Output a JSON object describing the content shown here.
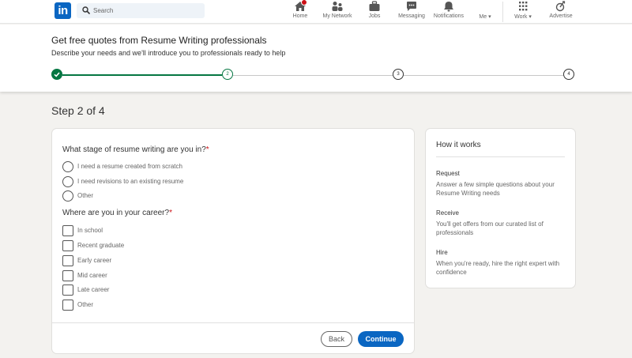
{
  "nav": {
    "logo_text": "in",
    "search_placeholder": "Search",
    "items": [
      {
        "label": "Home"
      },
      {
        "label": "My Network"
      },
      {
        "label": "Jobs"
      },
      {
        "label": "Messaging"
      },
      {
        "label": "Notifications"
      },
      {
        "label": "Me"
      },
      {
        "label": "Work"
      },
      {
        "label": "Advertise"
      }
    ]
  },
  "header": {
    "title": "Get free quotes from Resume Writing professionals",
    "subtitle": "Describe your needs and we'll introduce you to professionals ready to help",
    "steps": [
      "",
      "2",
      "3",
      "4"
    ],
    "current_step": 2,
    "total_steps": 4
  },
  "step_heading": "Step 2 of 4",
  "form": {
    "question1": {
      "label": "What stage of resume writing are you in?",
      "required_mark": "*",
      "options": [
        "I need a resume created from scratch",
        "I need revisions to an existing resume",
        "Other"
      ]
    },
    "question2": {
      "label": "Where are you in your career?",
      "required_mark": "*",
      "options": [
        "In school",
        "Recent graduate",
        "Early career",
        "Mid career",
        "Late career",
        "Other"
      ]
    },
    "back_label": "Back",
    "continue_label": "Continue"
  },
  "how_it_works": {
    "title": "How it works",
    "items": [
      {
        "title": "Request",
        "desc": "Answer a few simple questions about your Resume Writing needs"
      },
      {
        "title": "Receive",
        "desc": "You'll get offers from our curated list of professionals"
      },
      {
        "title": "Hire",
        "desc": "When you're ready, hire the right expert with confidence"
      }
    ]
  },
  "colors": {
    "brand": "#0a66c2",
    "progress_done": "#057642",
    "required": "#cc1016",
    "background": "#f3f2ef"
  }
}
